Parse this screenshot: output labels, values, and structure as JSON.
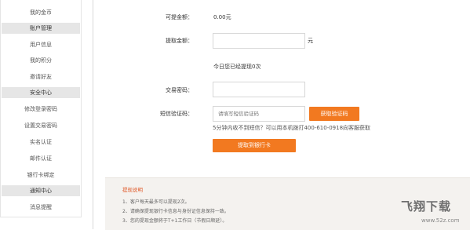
{
  "sidebar": {
    "items": [
      {
        "label": "我的金币",
        "type": "item"
      },
      {
        "label": "账户管理",
        "type": "head"
      },
      {
        "label": "用户信息",
        "type": "item"
      },
      {
        "label": "我的积分",
        "type": "item"
      },
      {
        "label": "邀请好友",
        "type": "item"
      },
      {
        "label": "安全中心",
        "type": "head"
      },
      {
        "label": "修改登录密码",
        "type": "item"
      },
      {
        "label": "设置交易密码",
        "type": "item"
      },
      {
        "label": "实名认证",
        "type": "item"
      },
      {
        "label": "邮件认证",
        "type": "item"
      },
      {
        "label": "银行卡绑定",
        "type": "item"
      },
      {
        "label": "通知中心",
        "type": "head"
      },
      {
        "label": "消息提醒",
        "type": "item"
      }
    ]
  },
  "form": {
    "available_label": "可提金额：",
    "available_value": "0.00元",
    "amount_label": "提取金额：",
    "amount_unit": "元",
    "amount_hint": "今日您已经提现0次",
    "password_label": "交易密码：",
    "sms_label": "短信验证码：",
    "sms_placeholder": "请填写短信验证码",
    "sms_button": "获取验证码",
    "sms_help": "5分钟内收不到短信？可以用本机拨打400-610-0918向客服获取",
    "submit_button": "提取到银行卡"
  },
  "notice": {
    "title": "提现说明",
    "lines": [
      "1、客户每天最多可以提现2次。",
      "2、请确保提现银行卡信息与身份证信息保持一致。",
      "3、您的提现金额将于T+1工作日（节假日顺延）。"
    ]
  },
  "watermark": {
    "text": "飞翔下载",
    "url": "www.52z.com"
  },
  "colors": {
    "accent": "#f27920",
    "sidebar_head_bg": "#e6e6e6",
    "notice_bg": "#f4f2ef",
    "notice_title": "#e05a2a"
  }
}
